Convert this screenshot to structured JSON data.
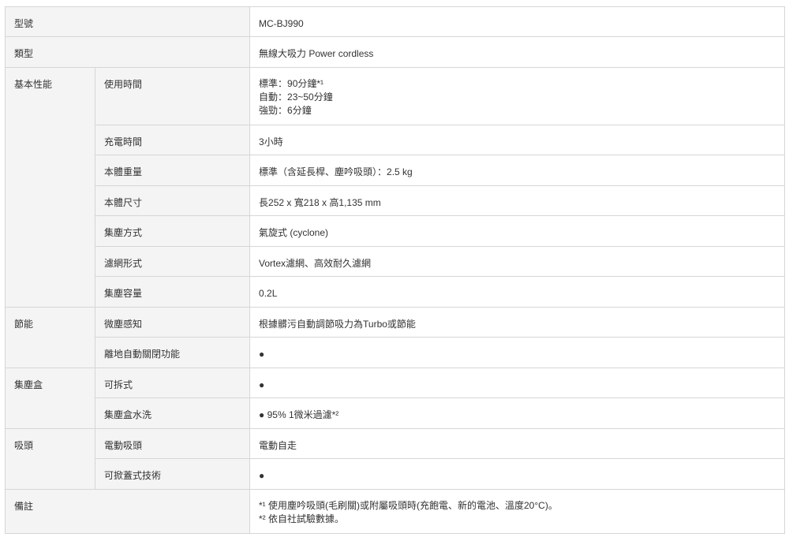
{
  "rows": [
    {
      "label": "型號",
      "value": "MC-BJ990"
    },
    {
      "label": "類型",
      "value": "無線大吸力 Power cordless"
    }
  ],
  "basic": {
    "label": "基本性能",
    "items": [
      {
        "label": "使用時間",
        "lines": [
          "標準：90分鐘*¹",
          "自動：23~50分鐘",
          "強勁：6分鐘"
        ]
      },
      {
        "label": "充電時間",
        "value": "3小時"
      },
      {
        "label": "本體重量",
        "value": "標準（含延長桿、塵吟吸頭）：2.5 kg"
      },
      {
        "label": "本體尺寸",
        "value": "長252 x 寬218 x 高1,135 mm"
      },
      {
        "label": "集塵方式",
        "value": "氣旋式 (cyclone)"
      },
      {
        "label": "濾網形式",
        "value": "Vortex濾網、高效耐久濾網"
      },
      {
        "label": "集塵容量",
        "value": "0.2L"
      }
    ]
  },
  "energy": {
    "label": "節能",
    "items": [
      {
        "label": "微塵感知",
        "value": "根據髒污自動調節吸力為Turbo或節能"
      },
      {
        "label": "離地自動關閉功能",
        "value": "●"
      }
    ]
  },
  "dustbox": {
    "label": "集塵盒",
    "items": [
      {
        "label": "可拆式",
        "value": "●"
      },
      {
        "label": "集塵盒水洗",
        "value": "● 95% 1微米過濾*²"
      }
    ]
  },
  "head": {
    "label": "吸頭",
    "items": [
      {
        "label": "電動吸頭",
        "value": "電動自走"
      },
      {
        "label": "可掀蓋式技術",
        "value": "●"
      }
    ]
  },
  "notes": {
    "label": "備註",
    "lines": [
      "*¹ 使用塵吟吸頭(毛刷關)或附屬吸頭時(充飽電、新的電池、溫度20°C)。",
      "*² 依自社試驗數據。"
    ]
  }
}
